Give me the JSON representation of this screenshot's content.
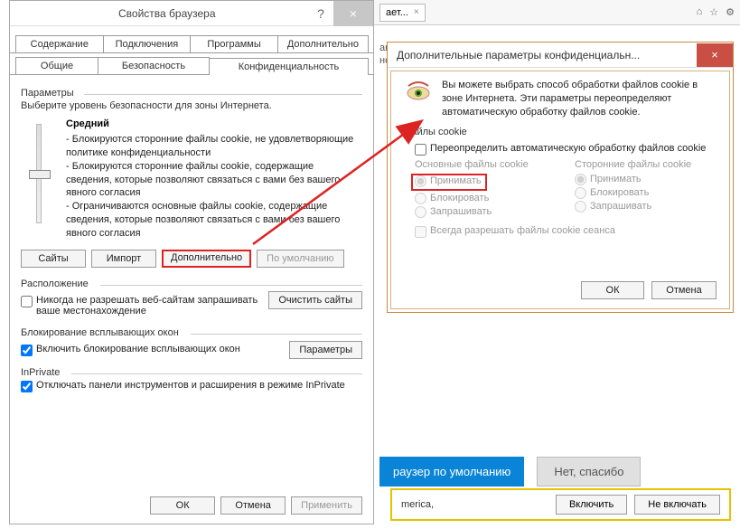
{
  "props_dialog": {
    "title": "Свойства браузера",
    "help_symbol": "?",
    "close_symbol": "×",
    "tabs_top": [
      "Содержание",
      "Подключения",
      "Программы",
      "Дополнительно"
    ],
    "tabs_bottom": [
      "Общие",
      "Безопасность",
      "Конфиденциальность"
    ],
    "params_label": "Параметры",
    "select_level_desc": "Выберите уровень безопасности для зоны Интернета.",
    "level_title": "Средний",
    "level_body": "- Блокируются сторонние файлы cookie, не удовлетворяющие политике конфиденциальности\n- Блокируются сторонние файлы cookie, содержащие сведения, которые позволяют связаться с вами без вашего явного согласия\n- Ограничиваются основные файлы cookie, содержащие сведения, которые позволяют связаться с вами без вашего явного согласия",
    "btn_sites": "Сайты",
    "btn_import": "Импорт",
    "btn_advanced": "Дополнительно",
    "btn_default": "По умолчанию",
    "location_label": "Расположение",
    "chk_never_allow": "Никогда не разрешать веб-сайтам запрашивать ваше местонахождение",
    "btn_clear_sites": "Очистить сайты",
    "popup_label": "Блокирование всплывающих окон",
    "chk_popup": "Включить блокирование всплывающих окон",
    "btn_popup_params": "Параметры",
    "inprivate_label": "InPrivate",
    "chk_inprivate": "Отключать панели инструментов и расширения в режиме InPrivate",
    "btn_ok": "ОК",
    "btn_cancel": "Отмена",
    "btn_apply": "Применить"
  },
  "adv_dialog": {
    "title": "Дополнительные параметры конфиденциальн...",
    "close_symbol": "×",
    "desc": "Вы можете выбрать способ обработки файлов cookie в зоне Интернета. Эти параметры переопределяют автоматическую обработку файлов cookie.",
    "cookies_label": "Файлы cookie",
    "chk_override": "Переопределить автоматическую обработку файлов cookie",
    "col1_head": "Основные файлы cookie",
    "col2_head": "Сторонние файлы cookie",
    "opt_accept": "Принимать",
    "opt_block": "Блокировать",
    "opt_prompt": "Запрашивать",
    "chk_session": "Всегда разрешать файлы cookie сеанса",
    "btn_ok": "ОК",
    "btn_cancel": "Отмена"
  },
  "browser": {
    "tab_text": "ает...",
    "tab_close": "×",
    "icon_home": "⌂",
    "icon_star": "☆",
    "icon_gear": "⚙",
    "big_line1": "аниц в полноэкранном",
    "big_line2": "но подходит для",
    "blue_btn": "раузер по умолчанию",
    "gray_btn": "Нет, спасибо",
    "yellow_text": "merica,",
    "btn_enable": "Включить",
    "btn_disable": "Не включать"
  }
}
